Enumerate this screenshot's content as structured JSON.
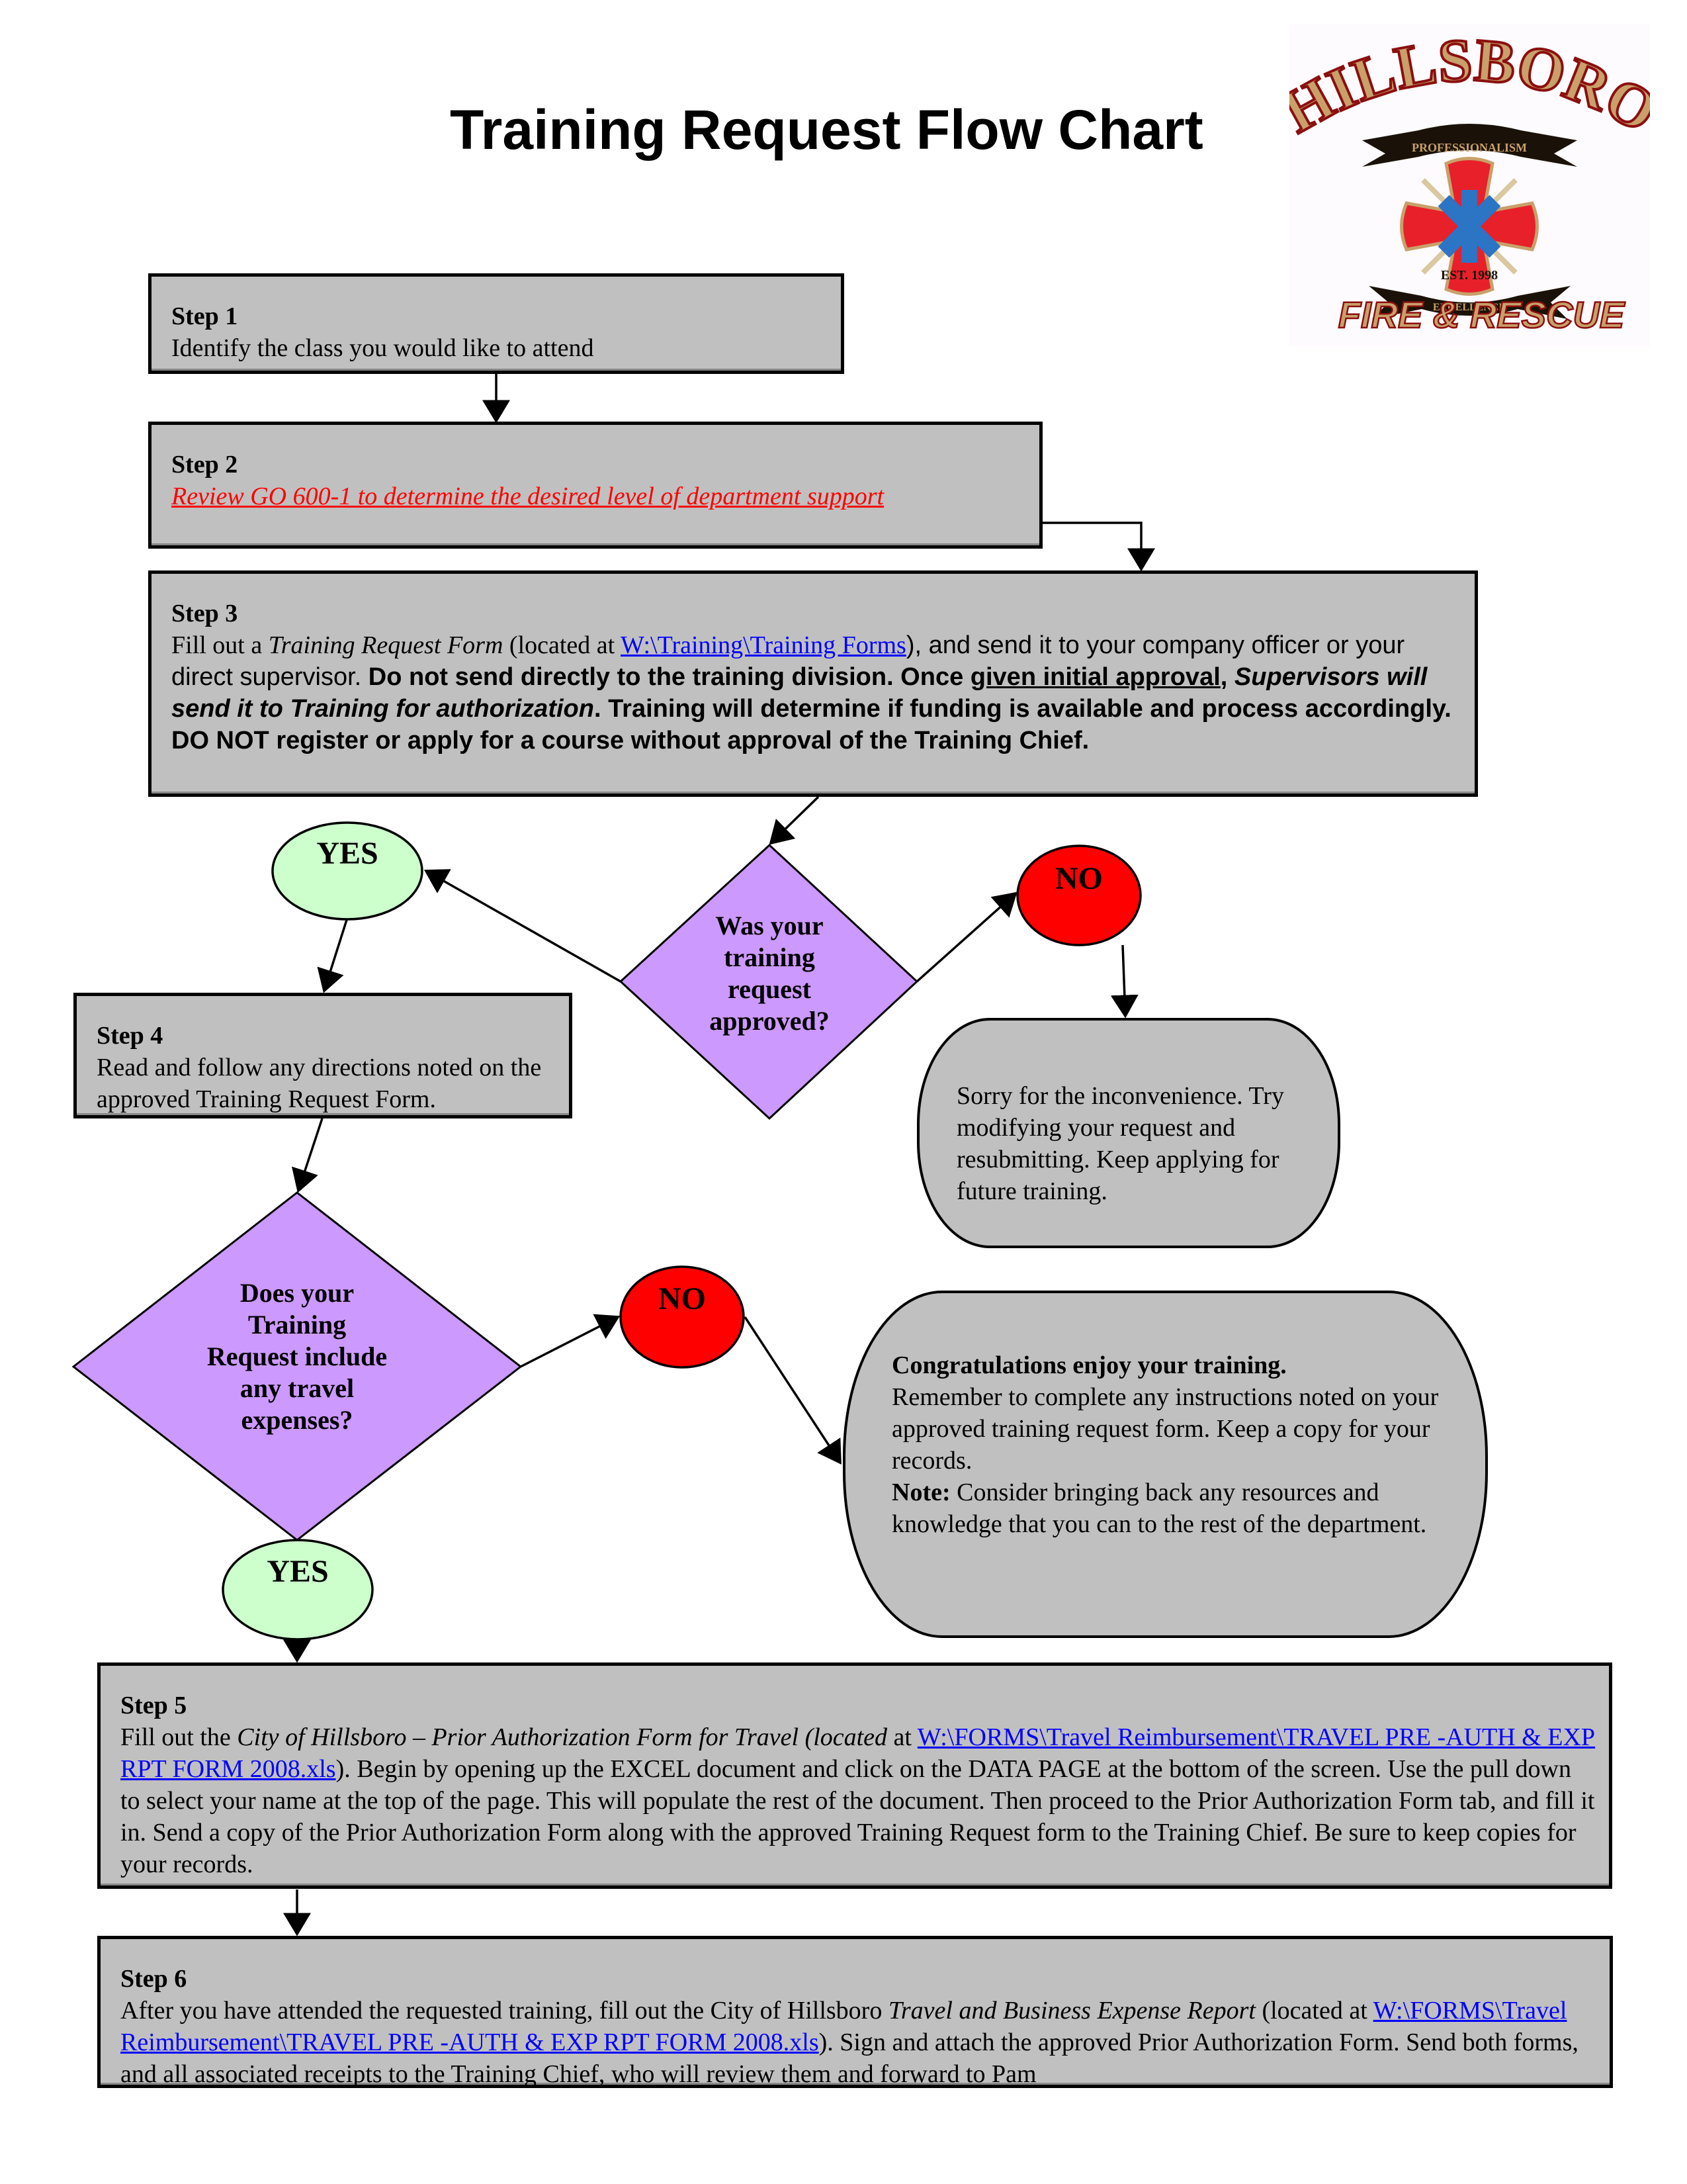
{
  "title": "Training Request Flow Chart",
  "logo": {
    "top_text": "HILLSBORO",
    "banner_top": "PROFESSIONALISM",
    "badge_text": "EST. 1998",
    "banner_bottom": "EXCELLENCE",
    "bottom_text": "FIRE & RESCUE",
    "colors": {
      "gold": "#c9a06a",
      "red": "#e8202a",
      "blue": "#2c74c4",
      "dark": "#1a1208"
    }
  },
  "colors": {
    "box_fill": "#c0c0c0",
    "yes_fill": "#ccffcc",
    "no_fill": "#ff0000",
    "decision_fill": "#cc99ff",
    "link": "#0000ff",
    "red_link": "#ff0000"
  },
  "steps": {
    "step1": {
      "title": "Step 1",
      "text": "Identify the class you would like to attend"
    },
    "step2": {
      "title": "Step 2",
      "link_text": "Review GO 600-1 to determine the desired level of department support"
    },
    "step3": {
      "title": "Step 3",
      "p1": "Fill out a ",
      "form_name": "Training Request Form",
      "p2": " (located at ",
      "link_text": "W:\\Training\\Training Forms",
      "p3": "), and send it to your company officer or your direct supervisor.  ",
      "bold1": "Do not send directly to the training division. Once ",
      "underlined": "given initial approval",
      "bold2": ", ",
      "bold_italic": "Supervisors will send it to Training for authorization",
      "bold3": ". Training will determine if funding is available and process accordingly.  DO NOT register or apply for a course without approval of the Training Chief."
    },
    "step4": {
      "title": "Step 4",
      "text": "Read and follow any directions noted on the approved Training Request Form."
    },
    "step5": {
      "title": "Step 5",
      "p1": "Fill out the ",
      "form_name": "City of Hillsboro – Prior Authorization Form for Travel (located",
      "p2": " at ",
      "link_text": "W:\\FORMS\\Travel Reimbursement\\TRAVEL PRE -AUTH & EXP RPT FORM 2008.xls",
      "p3": ").  Begin by opening up the EXCEL document and click on the DATA PAGE at the bottom of the screen.  Use the pull down to select your name at the top of the page.  This will populate the rest of the document.  Then proceed to the Prior Authorization Form tab, and fill it in.  Send a copy of the Prior Authorization Form along with the approved Training Request form to the Training Chief.  Be sure to keep copies for your records."
    },
    "step6": {
      "title": "Step 6",
      "p1": "After you have attended the requested training, fill out the City of Hillsboro ",
      "form_name": "Travel and Business Expense Report",
      "p2": " (located at ",
      "link_text": "W:\\FORMS\\Travel Reimbursement\\TRAVEL PRE -AUTH & EXP RPT FORM 2008.xls",
      "p3": ").  Sign and attach the approved Prior Authorization Form.  Send both forms, and all associated receipts to the Training Chief, who will review them and forward to Pam"
    }
  },
  "decisions": {
    "approved": {
      "question": "Was your training request approved?",
      "lines": [
        "Was your",
        "training",
        "request",
        "approved?"
      ]
    },
    "travel": {
      "question": "Does your Training Request include any travel expenses?",
      "lines": [
        "Does your",
        "Training",
        "Request include",
        "any travel",
        "expenses?"
      ]
    }
  },
  "outcomes": {
    "yes1": "YES",
    "no1": "NO",
    "yes2": "YES",
    "no2": "NO"
  },
  "terminals": {
    "sorry": "Sorry for the inconvenience. Try modifying your request and resubmitting.  Keep applying for future training.",
    "congrats": {
      "heading": "Congratulations enjoy your training.",
      "text": "Remember to complete any instructions noted on your approved training request form.  Keep a copy for your records.",
      "note_label": "Note:",
      "note_text": "  Consider bringing back any resources and knowledge that you can to the rest of the department."
    }
  }
}
